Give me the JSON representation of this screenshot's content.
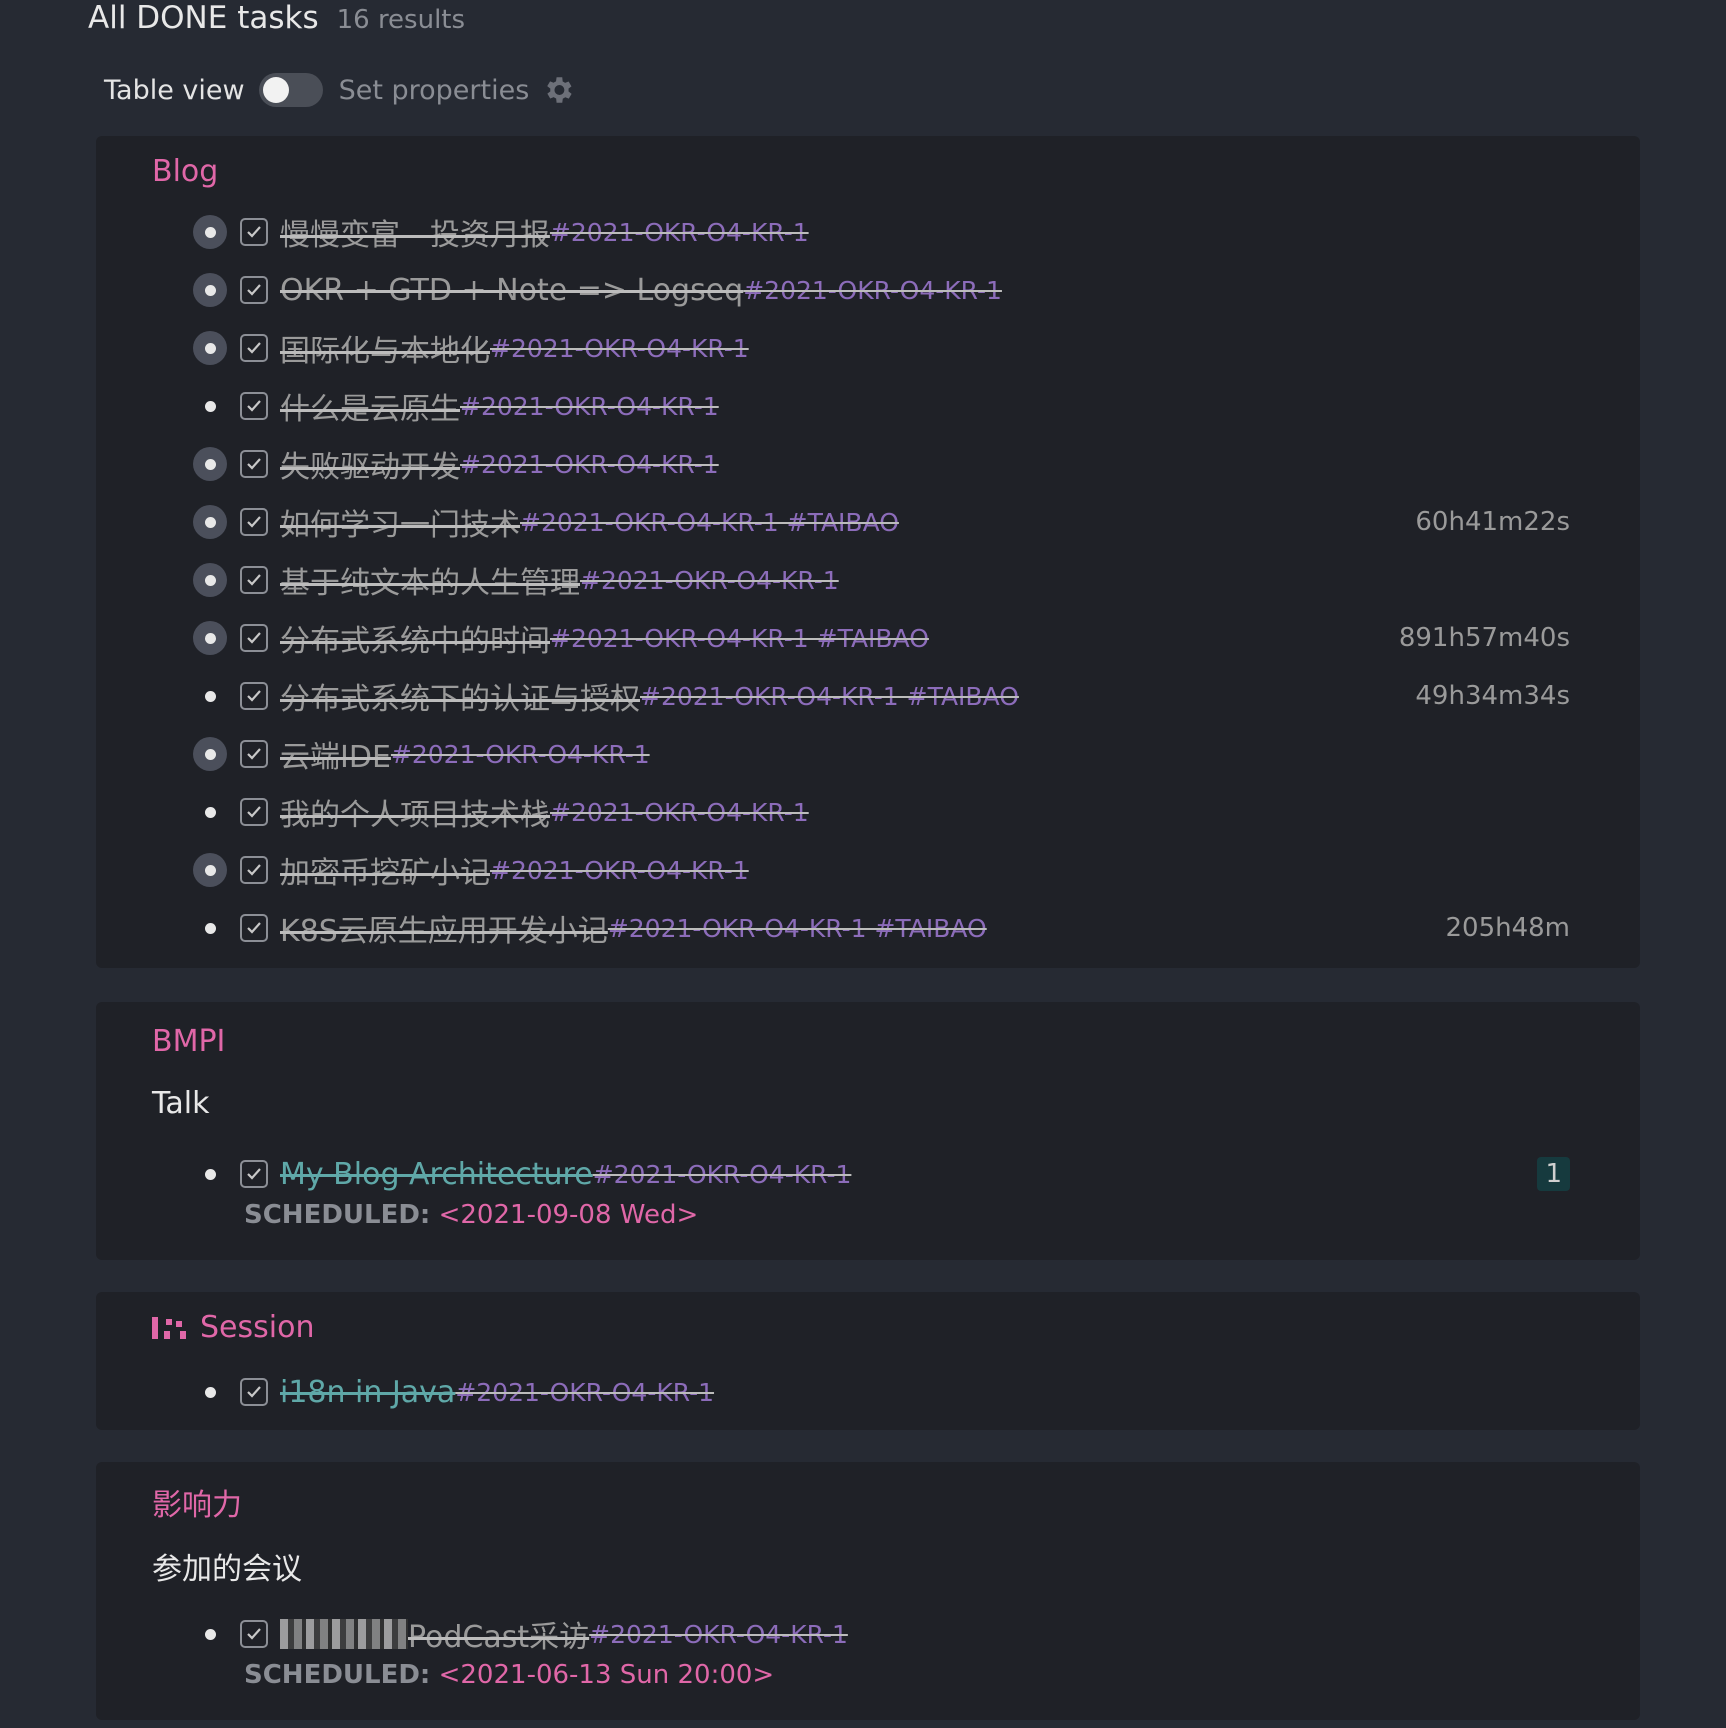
{
  "query": {
    "title": "All DONE tasks",
    "count": "16 results"
  },
  "controls": {
    "table_view_label": "Table view",
    "table_view_on": false,
    "set_properties_label": "Set properties"
  },
  "groups": [
    {
      "title": "Blog",
      "tasks": [
        {
          "text": "慢慢变富 - 投资月报 ",
          "tags": "#2021-OKR-O4-KR-1",
          "duration": ""
        },
        {
          "text": "OKR + GTD + Note => Logseq ",
          "tags": "#2021-OKR-O4-KR-1",
          "duration": ""
        },
        {
          "text": "国际化与本地化 ",
          "tags": "#2021-OKR-O4-KR-1",
          "duration": ""
        },
        {
          "text": "什么是云原生 ",
          "tags": "#2021-OKR-O4-KR-1",
          "duration": ""
        },
        {
          "text": "失败驱动开发 ",
          "tags": "#2021-OKR-O4-KR-1",
          "duration": ""
        },
        {
          "text": "如何学习一门技术 ",
          "tags": "#2021-OKR-O4-KR-1 #TAIBAO",
          "duration": "60h41m22s"
        },
        {
          "text": "基于纯文本的人生管理 ",
          "tags": "#2021-OKR-O4-KR-1",
          "duration": ""
        },
        {
          "text": "分布式系统中的时间 ",
          "tags": "#2021-OKR-O4-KR-1 #TAIBAO",
          "duration": "891h57m40s"
        },
        {
          "text": "分布式系统下的认证与授权 ",
          "tags": "#2021-OKR-O4-KR-1 #TAIBAO",
          "duration": "49h34m34s"
        },
        {
          "text": "云端IDE ",
          "tags": "#2021-OKR-O4-KR-1",
          "duration": ""
        },
        {
          "text": "我的个人项目技术栈 ",
          "tags": "#2021-OKR-O4-KR-1",
          "duration": ""
        },
        {
          "text": "加密币挖矿小记 ",
          "tags": "#2021-OKR-O4-KR-1",
          "duration": ""
        },
        {
          "text": "K8S云原生应用开发小记 ",
          "tags": "#2021-OKR-O4-KR-1 #TAIBAO",
          "duration": "205h48m"
        }
      ]
    },
    {
      "title": "BMPI",
      "subheading": "Talk",
      "tasks": [
        {
          "text": "My Blog Architecture ",
          "tags": "#2021-OKR-O4-KR-1",
          "badge": "1",
          "scheduled_label": "SCHEDULED:",
          "scheduled_value": "<2021-09-08 Wed>"
        }
      ]
    },
    {
      "title": "Session",
      "tasks": [
        {
          "text": "i18n in Java ",
          "tags": "#2021-OKR-O4-KR-1"
        }
      ]
    },
    {
      "title": "影响力",
      "subheading": "参加的会议",
      "tasks": [
        {
          "text": "PodCast采访 ",
          "tags": "#2021-OKR-O4-KR-1 ",
          "scheduled_label": "SCHEDULED:",
          "scheduled_value": "<2021-06-13 Sun 20:00>"
        }
      ]
    }
  ]
}
